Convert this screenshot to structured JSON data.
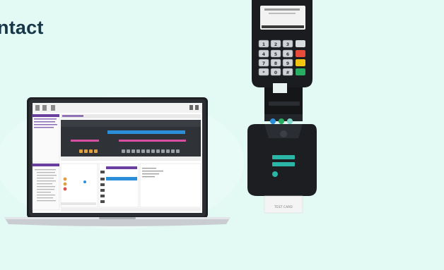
{
  "page": {
    "heading": "ntact",
    "background": "#e2f9f4",
    "heading_color": "#17364a"
  },
  "laptop": {
    "description_icon": "laptop-icon",
    "screen_app": {
      "panel_accent": "#6b3fa0",
      "trace_bar_color": "#2a8fd8",
      "trace_pink": "#d64fa0",
      "trace_amber": "#e0a040"
    }
  },
  "terminal": {
    "icon": "payment-terminal-icon",
    "keypad_keys": [
      "1",
      "2",
      "3",
      "4",
      "5",
      "6",
      "7",
      "8",
      "9",
      "*",
      "0",
      "#"
    ],
    "function_keys": [
      "cancel",
      "clear",
      "enter"
    ],
    "card_label": "TEST CARD",
    "logo_color": "#2bb5a6"
  }
}
